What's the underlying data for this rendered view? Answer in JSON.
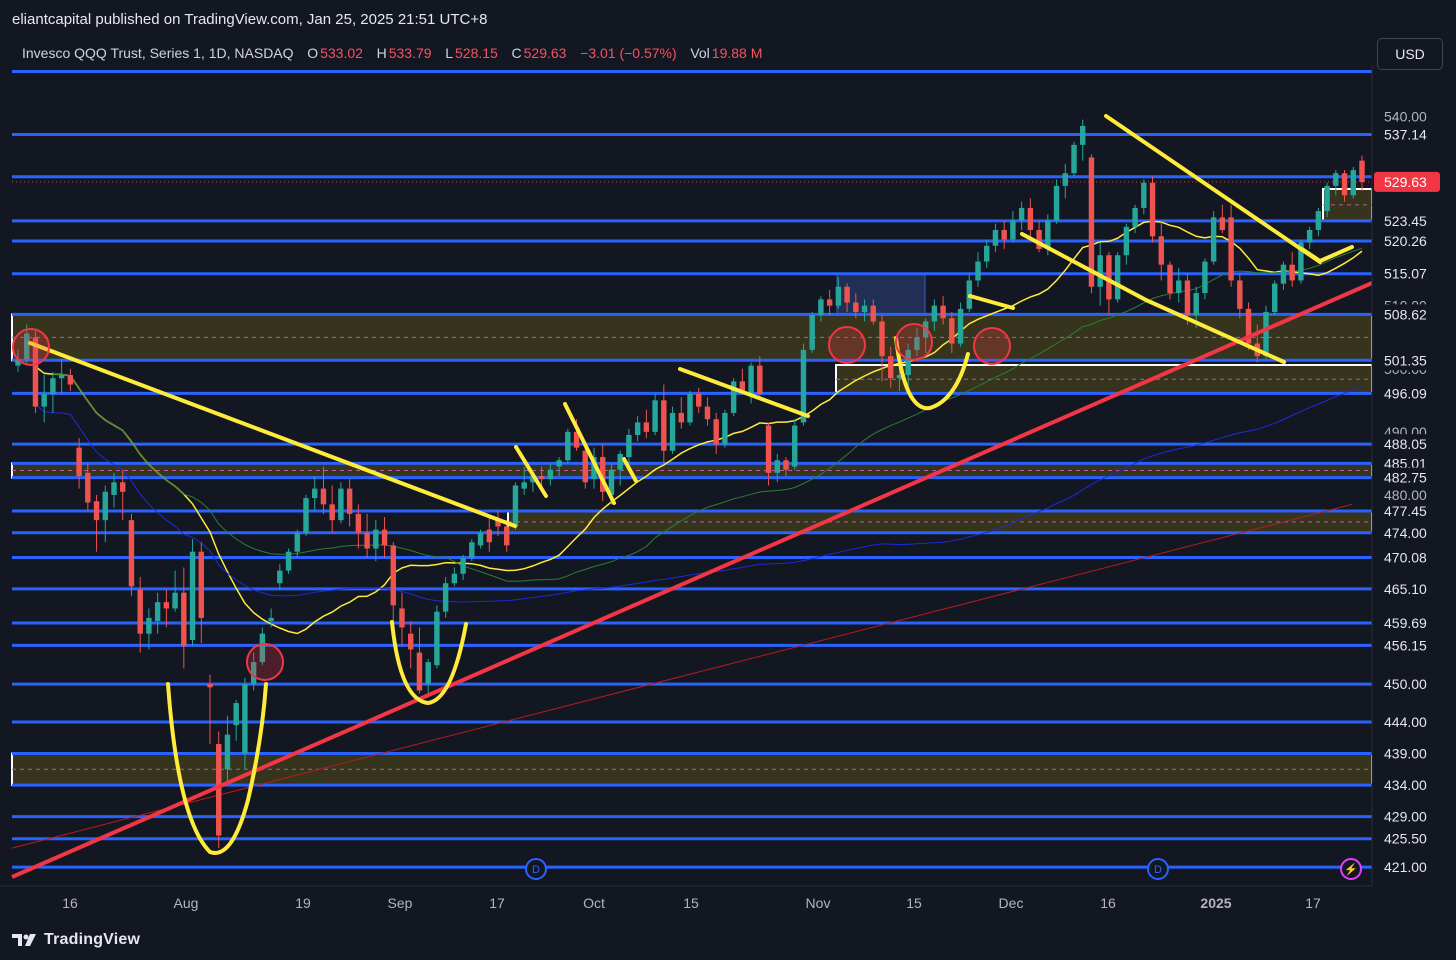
{
  "header": {
    "published": "eliantcapital published on TradingView.com, Jan 25, 2025 21:51 UTC+8"
  },
  "legend": {
    "symbol": "Invesco QQQ Trust, Series 1, 1D, NASDAQ",
    "open_label": "O",
    "open": "533.02",
    "high_label": "H",
    "high": "533.79",
    "low_label": "L",
    "low": "528.15",
    "close_label": "C",
    "close": "529.63",
    "change": "−3.01 (−0.57%)",
    "vol_label": "Vol",
    "vol": "19.88 M"
  },
  "currency": "USD",
  "footer": {
    "brand": "TradingView"
  },
  "colors": {
    "background": "#131722",
    "level_line": "#2962ff",
    "zone_border": "#ffffff",
    "zone_fill": "#3d3a1c",
    "trendline": "#f23645",
    "drawing": "#ffeb3b",
    "up_candle": "#26a69a",
    "down_candle": "#ef5350",
    "last_price_badge": "#f23645"
  },
  "chart_data": {
    "type": "candlestick",
    "symbol": "QQQ",
    "timeframe": "1D",
    "ylim": [
      418,
      548
    ],
    "x_ticks": [
      "16",
      "Aug",
      "19",
      "Sep",
      "17",
      "Oct",
      "15",
      "Nov",
      "15",
      "Dec",
      "16",
      "2025",
      "17"
    ],
    "y_ticks": [
      "540.00",
      "510.00",
      "500.00",
      "490.00",
      "480.00"
    ],
    "price_levels": [
      547.12,
      537.14,
      530.45,
      523.45,
      520.26,
      515.07,
      508.62,
      501.35,
      496.09,
      488.05,
      485.01,
      482.75,
      477.45,
      474.0,
      470.08,
      465.1,
      459.69,
      456.15,
      450.0,
      444.0,
      439.0,
      434.0,
      429.0,
      425.5,
      421.0
    ],
    "price_labels": [
      "537.14",
      "530.45",
      "523.45",
      "520.26",
      "515.07",
      "508.62",
      "501.35",
      "496.09",
      "488.05",
      "485.01",
      "482.75",
      "477.45",
      "474.00",
      "470.08",
      "465.10",
      "459.69",
      "456.15",
      "450.00",
      "444.00",
      "439.00",
      "434.00",
      "429.00",
      "425.50",
      "421.00"
    ],
    "zones": [
      [
        501.35,
        508.62
      ],
      [
        496.09,
        500.6
      ],
      [
        482.75,
        485.01
      ],
      [
        474.0,
        477.45
      ],
      [
        434.0,
        439.0
      ],
      [
        523.45,
        528.5
      ]
    ],
    "last_price": "529.63",
    "ohlc": [
      [
        500.5,
        503.0,
        499.5,
        501.5
      ],
      [
        501.5,
        507.0,
        500.5,
        505.6
      ],
      [
        505.0,
        506.0,
        493.0,
        494.0
      ],
      [
        494.0,
        499.0,
        491.5,
        496.0
      ],
      [
        496.0,
        499.5,
        493.0,
        498.5
      ],
      [
        498.5,
        501.5,
        496.0,
        499.0
      ],
      [
        499.0,
        500.0,
        496.5,
        497.5
      ],
      [
        487.5,
        489.0,
        481.0,
        483.0
      ],
      [
        483.5,
        485.0,
        477.5,
        478.8
      ],
      [
        479.0,
        480.0,
        471.0,
        476.0
      ],
      [
        476.0,
        481.5,
        472.5,
        480.5
      ],
      [
        480.0,
        483.5,
        478.0,
        482.0
      ],
      [
        482.0,
        484.0,
        476.0,
        480.5
      ],
      [
        476.0,
        477.0,
        464.0,
        465.5
      ],
      [
        465.0,
        467.0,
        455.0,
        458.0
      ],
      [
        458.0,
        462.0,
        455.5,
        460.5
      ],
      [
        460.0,
        464.5,
        458.0,
        463.0
      ],
      [
        463.0,
        465.0,
        459.0,
        462.0
      ],
      [
        462.0,
        468.0,
        461.5,
        464.5
      ],
      [
        464.5,
        468.5,
        452.5,
        456.0
      ],
      [
        457.0,
        473.0,
        456.0,
        471.0
      ],
      [
        471.0,
        472.5,
        456.5,
        460.5
      ],
      [
        450.0,
        451.5,
        440.5,
        449.5
      ],
      [
        440.5,
        442.5,
        424.0,
        426.0
      ],
      [
        436.5,
        445.0,
        434.0,
        442.0
      ],
      [
        443.5,
        447.5,
        441.0,
        447.0
      ],
      [
        439.0,
        451.0,
        436.5,
        450.0
      ],
      [
        450.0,
        455.0,
        449.0,
        453.5
      ],
      [
        453.5,
        459.0,
        453.0,
        458.0
      ],
      [
        460.0,
        462.0,
        459.0,
        460.5
      ],
      [
        466.0,
        469.0,
        465.0,
        468.0
      ],
      [
        468.0,
        471.5,
        467.5,
        471.0
      ],
      [
        471.0,
        474.5,
        470.0,
        474.0
      ],
      [
        474.0,
        480.0,
        473.5,
        479.5
      ],
      [
        479.5,
        483.0,
        477.5,
        481.0
      ],
      [
        481.0,
        484.5,
        477.0,
        478.5
      ],
      [
        478.5,
        481.5,
        474.0,
        476.0
      ],
      [
        476.0,
        482.0,
        475.5,
        481.0
      ],
      [
        481.0,
        482.5,
        475.0,
        477.0
      ],
      [
        477.0,
        478.5,
        471.5,
        474.0
      ],
      [
        474.0,
        477.0,
        470.0,
        471.5
      ],
      [
        471.5,
        476.0,
        469.5,
        474.5
      ],
      [
        474.5,
        476.5,
        470.0,
        472.0
      ],
      [
        472.0,
        472.5,
        458.5,
        462.5
      ],
      [
        462.0,
        464.5,
        456.0,
        459.0
      ],
      [
        458.0,
        460.0,
        452.5,
        455.5
      ],
      [
        455.0,
        459.0,
        448.5,
        449.0
      ],
      [
        450.0,
        454.0,
        448.0,
        453.5
      ],
      [
        453.0,
        462.5,
        452.5,
        461.5
      ],
      [
        461.5,
        467.0,
        460.5,
        466.0
      ],
      [
        466.0,
        468.5,
        465.5,
        467.5
      ],
      [
        467.5,
        470.5,
        466.5,
        470.0
      ],
      [
        470.0,
        473.0,
        469.5,
        472.5
      ],
      [
        472.0,
        474.5,
        471.5,
        474.0
      ],
      [
        474.5,
        476.5,
        471.0,
        472.5
      ],
      [
        476.0,
        477.5,
        473.5,
        475.0
      ],
      [
        475.0,
        476.0,
        471.0,
        472.0
      ],
      [
        475.0,
        482.0,
        474.5,
        481.5
      ],
      [
        481.0,
        484.5,
        480.0,
        482.0
      ],
      [
        482.0,
        483.5,
        480.5,
        483.0
      ],
      [
        483.0,
        484.5,
        481.0,
        482.5
      ],
      [
        482.5,
        485.0,
        481.5,
        484.0
      ],
      [
        484.5,
        486.0,
        483.0,
        485.5
      ],
      [
        485.5,
        490.5,
        485.0,
        490.0
      ],
      [
        490.0,
        492.0,
        487.0,
        487.5
      ],
      [
        487.0,
        488.0,
        481.0,
        482.0
      ],
      [
        482.5,
        487.5,
        481.0,
        486.0
      ],
      [
        486.0,
        488.0,
        479.0,
        480.5
      ],
      [
        480.0,
        485.0,
        478.5,
        484.0
      ],
      [
        484.0,
        487.0,
        481.5,
        486.5
      ],
      [
        486.0,
        490.5,
        485.0,
        489.5
      ],
      [
        489.5,
        492.5,
        488.5,
        491.5
      ],
      [
        491.5,
        493.5,
        489.0,
        490.0
      ],
      [
        490.0,
        496.0,
        489.5,
        495.0
      ],
      [
        495.0,
        497.5,
        485.0,
        487.0
      ],
      [
        487.0,
        494.0,
        486.5,
        493.0
      ],
      [
        493.0,
        495.5,
        490.5,
        491.5
      ],
      [
        491.5,
        496.5,
        491.0,
        496.0
      ],
      [
        496.0,
        497.0,
        493.0,
        494.0
      ],
      [
        494.0,
        495.5,
        491.0,
        492.0
      ],
      [
        492.0,
        493.0,
        486.5,
        488.0
      ],
      [
        488.0,
        493.5,
        487.5,
        493.0
      ],
      [
        493.0,
        498.5,
        492.5,
        498.0
      ],
      [
        498.0,
        500.0,
        496.0,
        496.5
      ],
      [
        496.0,
        501.0,
        494.5,
        500.5
      ],
      [
        500.5,
        502.0,
        495.5,
        496.0
      ],
      [
        491.0,
        491.5,
        481.5,
        483.5
      ],
      [
        483.5,
        486.5,
        482.0,
        485.5
      ],
      [
        485.5,
        486.0,
        483.0,
        484.0
      ],
      [
        484.5,
        492.0,
        484.0,
        491.0
      ],
      [
        491.5,
        504.0,
        491.0,
        503.0
      ],
      [
        503.0,
        509.0,
        502.5,
        508.5
      ],
      [
        508.5,
        511.5,
        507.5,
        511.0
      ],
      [
        511.0,
        512.5,
        508.5,
        510.0
      ],
      [
        510.0,
        514.5,
        509.5,
        513.0
      ],
      [
        513.0,
        513.5,
        509.0,
        510.5
      ],
      [
        510.5,
        512.0,
        508.0,
        509.0
      ],
      [
        509.0,
        511.0,
        507.5,
        510.0
      ],
      [
        510.0,
        511.0,
        507.0,
        507.5
      ],
      [
        507.5,
        508.5,
        498.0,
        502.0
      ],
      [
        502.0,
        503.5,
        497.0,
        498.5
      ],
      [
        498.5,
        502.0,
        496.5,
        499.0
      ],
      [
        499.0,
        504.0,
        497.0,
        503.0
      ],
      [
        503.0,
        506.5,
        502.0,
        505.0
      ],
      [
        505.0,
        508.0,
        502.5,
        507.5
      ],
      [
        507.5,
        511.0,
        506.0,
        510.0
      ],
      [
        510.0,
        511.5,
        507.0,
        508.0
      ],
      [
        508.0,
        509.0,
        502.5,
        504.0
      ],
      [
        504.0,
        510.5,
        503.5,
        509.5
      ],
      [
        509.5,
        515.0,
        509.0,
        514.0
      ],
      [
        514.0,
        518.5,
        513.0,
        517.0
      ],
      [
        517.0,
        520.5,
        516.0,
        519.5
      ],
      [
        519.5,
        523.0,
        518.5,
        522.0
      ],
      [
        522.0,
        523.5,
        519.0,
        520.5
      ],
      [
        520.5,
        525.0,
        520.0,
        523.5
      ],
      [
        523.5,
        526.5,
        522.0,
        525.5
      ],
      [
        525.5,
        527.0,
        521.0,
        522.0
      ],
      [
        522.0,
        523.5,
        518.5,
        519.0
      ],
      [
        519.0,
        524.5,
        518.0,
        523.5
      ],
      [
        523.5,
        530.0,
        523.0,
        529.0
      ],
      [
        529.0,
        532.5,
        527.0,
        531.0
      ],
      [
        531.0,
        536.0,
        530.5,
        535.5
      ],
      [
        535.5,
        539.5,
        533.0,
        538.5
      ],
      [
        533.5,
        534.0,
        512.0,
        513.0
      ],
      [
        513.0,
        520.0,
        510.0,
        518.0
      ],
      [
        518.0,
        518.5,
        508.5,
        511.0
      ],
      [
        511.0,
        518.5,
        510.5,
        518.0
      ],
      [
        518.0,
        523.0,
        516.5,
        522.5
      ],
      [
        522.5,
        526.0,
        521.5,
        525.5
      ],
      [
        525.5,
        530.0,
        524.5,
        529.5
      ],
      [
        529.5,
        530.5,
        520.0,
        521.0
      ],
      [
        521.0,
        523.5,
        514.0,
        516.5
      ],
      [
        516.5,
        517.0,
        511.0,
        512.0
      ],
      [
        512.0,
        516.0,
        510.5,
        514.0
      ],
      [
        514.0,
        515.0,
        507.0,
        508.5
      ],
      [
        508.5,
        513.0,
        506.5,
        512.0
      ],
      [
        512.0,
        517.5,
        511.0,
        517.0
      ],
      [
        517.0,
        525.0,
        516.5,
        524.0
      ],
      [
        524.0,
        526.0,
        521.5,
        522.0
      ],
      [
        524.0,
        526.0,
        513.0,
        514.0
      ],
      [
        514.0,
        515.0,
        508.0,
        509.5
      ],
      [
        509.5,
        510.5,
        503.0,
        504.0
      ],
      [
        504.0,
        507.0,
        501.0,
        502.0
      ],
      [
        502.0,
        510.0,
        501.5,
        509.0
      ],
      [
        509.0,
        514.0,
        508.5,
        513.5
      ],
      [
        513.5,
        517.0,
        512.5,
        516.5
      ],
      [
        516.5,
        518.5,
        513.0,
        514.0
      ],
      [
        514.0,
        520.5,
        513.5,
        520.0
      ],
      [
        520.0,
        522.5,
        519.0,
        522.0
      ],
      [
        522.0,
        525.5,
        521.0,
        525.0
      ],
      [
        525.0,
        529.5,
        524.0,
        529.0
      ],
      [
        529.0,
        531.5,
        527.5,
        531.0
      ],
      [
        531.0,
        531.5,
        526.5,
        527.5
      ],
      [
        527.5,
        532.0,
        527.0,
        531.5
      ],
      [
        533.0,
        533.8,
        528.2,
        529.6
      ]
    ]
  }
}
